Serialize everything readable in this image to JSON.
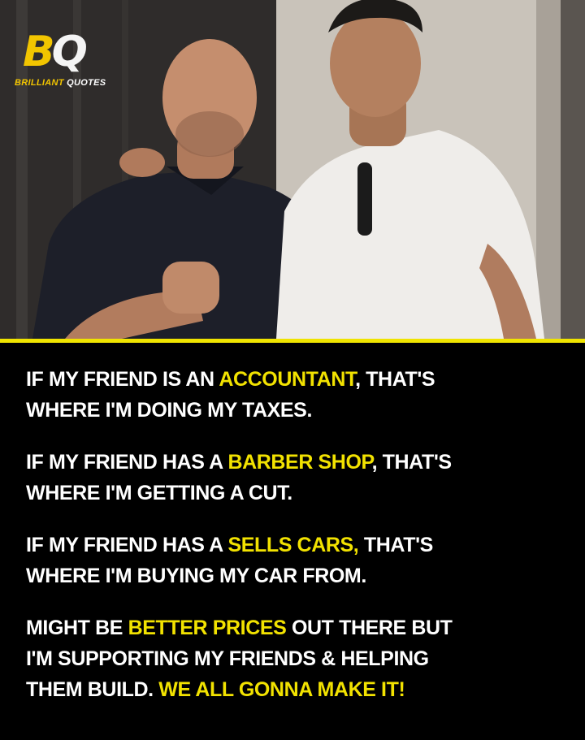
{
  "logo": {
    "mark_b": "B",
    "mark_q": "Q",
    "brand_first": "BRILLIANT",
    "brand_second": "QUOTES"
  },
  "colors": {
    "highlight": "#f2e200",
    "divider": "#f0e400",
    "background": "#000000",
    "text": "#ffffff"
  },
  "quote": {
    "paragraphs": [
      {
        "line1_a": "IF MY FRIEND IS AN ",
        "line1_hl": "ACCOUNTANT",
        "line1_b": ", THAT'S",
        "line2": "WHERE I'M DOING MY TAXES."
      },
      {
        "line1_a": "IF MY FRIEND HAS A ",
        "line1_hl": "BARBER SHOP",
        "line1_b": ", THAT'S",
        "line2": "WHERE I'M GETTING A CUT."
      },
      {
        "line1_a": "IF MY FRIEND HAS A ",
        "line1_hl": "SELLS CARS,",
        "line1_b": " THAT'S",
        "line2": "WHERE I'M BUYING MY CAR FROM."
      },
      {
        "line1_a": "MIGHT BE ",
        "line1_hl": "BETTER PRICES",
        "line1_b": " OUT THERE BUT",
        "line2": "I'M SUPPORTING MY FRIENDS & HELPING",
        "line3_a": "THEM BUILD. ",
        "line3_hl": "WE ALL GONNA MAKE IT!"
      }
    ]
  }
}
